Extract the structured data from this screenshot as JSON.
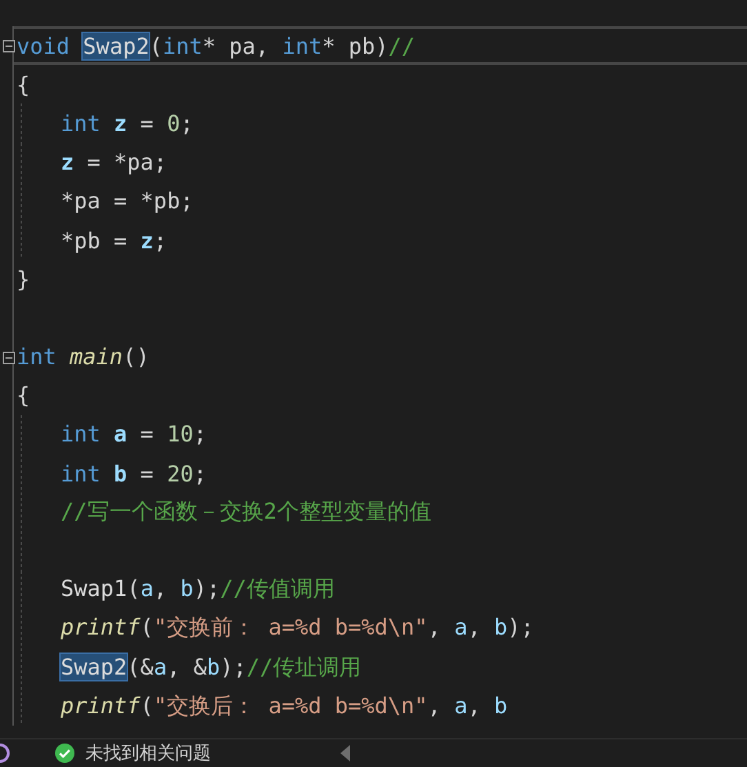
{
  "editor": {
    "lines": [
      {
        "fold": true,
        "current": true,
        "indent": false,
        "tokens": [
          {
            "text": "void ",
            "kind": "keyword"
          },
          {
            "text": "Swap2",
            "kind": "match"
          },
          {
            "text": "(",
            "kind": "punct"
          },
          {
            "text": "int",
            "kind": "keyword"
          },
          {
            "text": "* pa, ",
            "kind": "punct"
          },
          {
            "text": "int",
            "kind": "keyword"
          },
          {
            "text": "* pb)",
            "kind": "punct"
          },
          {
            "text": "//",
            "kind": "comment"
          }
        ]
      },
      {
        "fold": false,
        "current": false,
        "indent": false,
        "tokens": [
          {
            "text": "{",
            "kind": "punct"
          }
        ]
      },
      {
        "fold": false,
        "current": false,
        "indent": true,
        "tokens": [
          {
            "text": "int ",
            "kind": "keyword"
          },
          {
            "text": "z",
            "kind": "local"
          },
          {
            "text": " = ",
            "kind": "punct"
          },
          {
            "text": "0",
            "kind": "number"
          },
          {
            "text": ";",
            "kind": "punct"
          }
        ]
      },
      {
        "fold": false,
        "current": false,
        "indent": true,
        "tokens": [
          {
            "text": "z",
            "kind": "local"
          },
          {
            "text": " = *pa;",
            "kind": "punct"
          }
        ]
      },
      {
        "fold": false,
        "current": false,
        "indent": true,
        "tokens": [
          {
            "text": "*pa = *pb;",
            "kind": "punct"
          }
        ]
      },
      {
        "fold": false,
        "current": false,
        "indent": true,
        "tokens": [
          {
            "text": "*pb = ",
            "kind": "punct"
          },
          {
            "text": "z",
            "kind": "local"
          },
          {
            "text": ";",
            "kind": "punct"
          }
        ]
      },
      {
        "fold": false,
        "current": false,
        "indent": false,
        "tokens": [
          {
            "text": "}",
            "kind": "punct"
          }
        ]
      },
      {
        "fold": false,
        "current": false,
        "indent": false
      },
      {
        "fold": true,
        "current": false,
        "indent": false,
        "tokens": [
          {
            "text": "int ",
            "kind": "keyword"
          },
          {
            "text": "main",
            "kind": "function"
          },
          {
            "text": "()",
            "kind": "punct"
          }
        ]
      },
      {
        "fold": false,
        "current": false,
        "indent": false,
        "tokens": [
          {
            "text": "{",
            "kind": "punct"
          }
        ]
      },
      {
        "fold": false,
        "current": false,
        "indent": true,
        "tokens": [
          {
            "text": "int ",
            "kind": "keyword"
          },
          {
            "text": "a",
            "kind": "local"
          },
          {
            "text": " = ",
            "kind": "punct"
          },
          {
            "text": "10",
            "kind": "number"
          },
          {
            "text": ";",
            "kind": "punct"
          }
        ]
      },
      {
        "fold": false,
        "current": false,
        "indent": true,
        "tokens": [
          {
            "text": "int ",
            "kind": "keyword"
          },
          {
            "text": "b",
            "kind": "local"
          },
          {
            "text": " = ",
            "kind": "punct"
          },
          {
            "text": "20",
            "kind": "number"
          },
          {
            "text": ";",
            "kind": "punct"
          }
        ]
      },
      {
        "fold": false,
        "current": false,
        "indent": true,
        "tokens": [
          {
            "text": "//写一个函数－交换2个整型变量的值",
            "kind": "comment"
          }
        ]
      },
      {
        "fold": false,
        "current": false,
        "indent": true
      },
      {
        "fold": false,
        "current": false,
        "indent": true,
        "tokens": [
          {
            "text": "Swap1",
            "kind": "plain"
          },
          {
            "text": "(",
            "kind": "punct"
          },
          {
            "text": "a",
            "kind": "var"
          },
          {
            "text": ", ",
            "kind": "punct"
          },
          {
            "text": "b",
            "kind": "var"
          },
          {
            "text": ");",
            "kind": "punct"
          },
          {
            "text": "//传值调用",
            "kind": "comment"
          }
        ]
      },
      {
        "fold": false,
        "current": false,
        "indent": true,
        "tokens": [
          {
            "text": "printf",
            "kind": "function"
          },
          {
            "text": "(",
            "kind": "punct"
          },
          {
            "text": "\"交换前： a=%d b=%d\\n\"",
            "kind": "string"
          },
          {
            "text": ", ",
            "kind": "punct"
          },
          {
            "text": "a",
            "kind": "var"
          },
          {
            "text": ", ",
            "kind": "punct"
          },
          {
            "text": "b",
            "kind": "var"
          },
          {
            "text": ");",
            "kind": "punct"
          }
        ]
      },
      {
        "fold": false,
        "current": false,
        "indent": true,
        "tokens": [
          {
            "text": "Swap2",
            "kind": "match"
          },
          {
            "text": "(&",
            "kind": "punct"
          },
          {
            "text": "a",
            "kind": "var"
          },
          {
            "text": ", &",
            "kind": "punct"
          },
          {
            "text": "b",
            "kind": "var"
          },
          {
            "text": ");",
            "kind": "punct"
          },
          {
            "text": "//传址调用",
            "kind": "comment"
          }
        ]
      },
      {
        "fold": false,
        "current": false,
        "indent": true,
        "tokens": [
          {
            "text": "printf",
            "kind": "function"
          },
          {
            "text": "(",
            "kind": "punct"
          },
          {
            "text": "\"交换后： a=%d b=%d\\n\"",
            "kind": "string"
          },
          {
            "text": ", ",
            "kind": "punct"
          },
          {
            "text": "a",
            "kind": "var"
          },
          {
            "text": ", ",
            "kind": "punct"
          },
          {
            "text": "b",
            "kind": "var"
          }
        ]
      }
    ]
  },
  "status_bar": {
    "message": "未找到相关问题"
  }
}
